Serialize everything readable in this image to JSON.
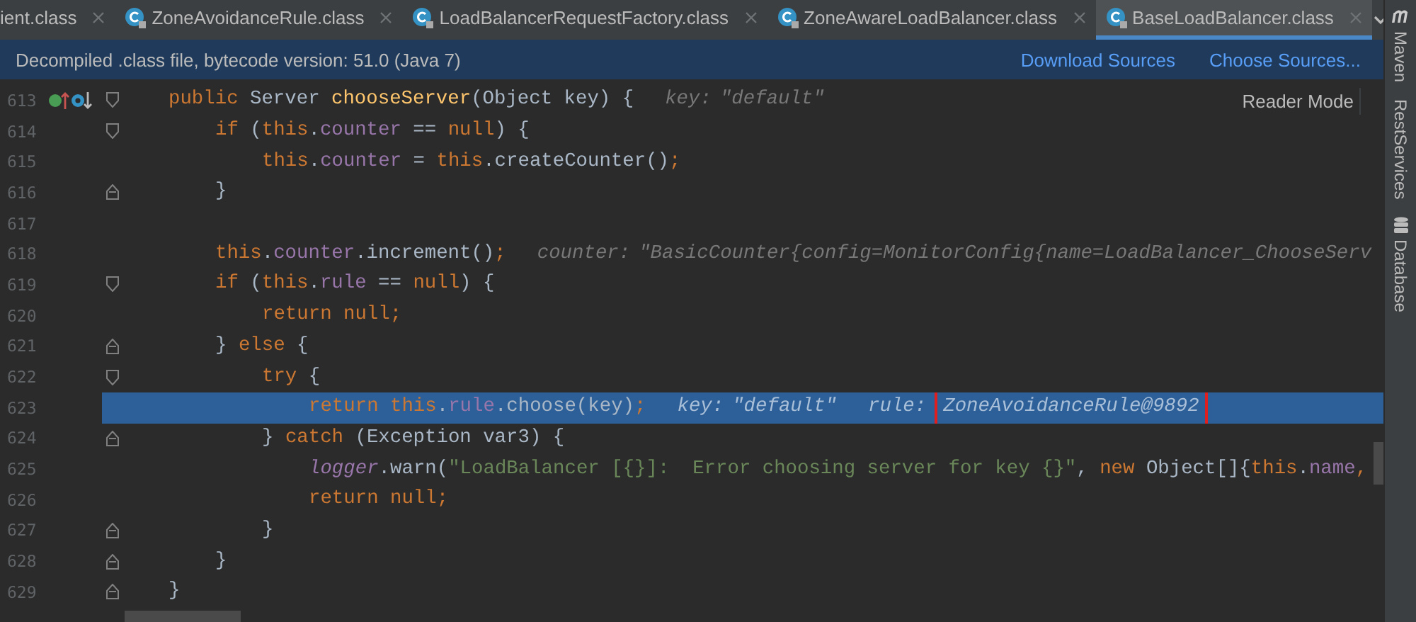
{
  "tabs": [
    {
      "label": "ient.class",
      "icon": false,
      "selected": false
    },
    {
      "label": "ZoneAvoidanceRule.class",
      "icon": true,
      "selected": false
    },
    {
      "label": "LoadBalancerRequestFactory.class",
      "icon": true,
      "selected": false
    },
    {
      "label": "ZoneAwareLoadBalancer.class",
      "icon": true,
      "selected": false
    },
    {
      "label": "BaseLoadBalancer.class",
      "icon": true,
      "selected": true
    }
  ],
  "banner": {
    "text": "Decompiled .class file, bytecode version: 51.0 (Java 7)",
    "links": [
      "Download Sources",
      "Choose Sources..."
    ]
  },
  "reader_mode": "Reader Mode",
  "tool_windows": [
    {
      "kind": "maven",
      "label": "Maven"
    },
    {
      "kind": "plain",
      "label": "RestServices"
    },
    {
      "kind": "database",
      "label": "Database"
    }
  ],
  "lines": [
    {
      "number": "613",
      "markers": true,
      "fold_start": true,
      "fold_end": false,
      "current": false,
      "tokens": [
        {
          "kind": "kw",
          "text": "public "
        },
        {
          "kind": "plain",
          "text": "Server "
        },
        {
          "kind": "decl",
          "text": "chooseServer"
        },
        {
          "kind": "plain",
          "text": "(Object key) {"
        }
      ],
      "hints": [
        {
          "label": "key:",
          "value": "\"default\"",
          "boxed": false
        }
      ]
    },
    {
      "number": "614",
      "markers": false,
      "fold_start": true,
      "fold_end": false,
      "current": false,
      "tokens": [
        {
          "kind": "kw",
          "text": "if "
        },
        {
          "kind": "plain",
          "text": "("
        },
        {
          "kind": "kw",
          "text": "this"
        },
        {
          "kind": "plain",
          "text": "."
        },
        {
          "kind": "field",
          "text": "counter "
        },
        {
          "kind": "plain",
          "text": "== "
        },
        {
          "kind": "kw",
          "text": "null"
        },
        {
          "kind": "plain",
          "text": ") {"
        }
      ]
    },
    {
      "number": "615",
      "markers": false,
      "fold_start": false,
      "fold_end": false,
      "current": false,
      "tokens": [
        {
          "kind": "kw",
          "text": "this"
        },
        {
          "kind": "plain",
          "text": "."
        },
        {
          "kind": "field",
          "text": "counter "
        },
        {
          "kind": "plain",
          "text": "= "
        },
        {
          "kind": "kw",
          "text": "this"
        },
        {
          "kind": "plain",
          "text": ".createCounter()"
        },
        {
          "kind": "kw",
          "text": ";"
        }
      ]
    },
    {
      "number": "616",
      "markers": false,
      "fold_start": false,
      "fold_end": true,
      "current": false,
      "tokens": [
        {
          "kind": "plain",
          "text": "}"
        }
      ]
    },
    {
      "number": "617",
      "markers": false,
      "fold_start": false,
      "fold_end": false,
      "current": false
    },
    {
      "number": "618",
      "markers": false,
      "fold_start": false,
      "fold_end": false,
      "current": false,
      "tokens": [
        {
          "kind": "kw",
          "text": "this"
        },
        {
          "kind": "plain",
          "text": "."
        },
        {
          "kind": "field",
          "text": "counter"
        },
        {
          "kind": "plain",
          "text": ".increment()"
        },
        {
          "kind": "kw",
          "text": ";"
        }
      ],
      "hints": [
        {
          "label": "counter:",
          "value": "\"BasicCounter{config=MonitorConfig{name=LoadBalancer_ChooseServ",
          "boxed": false
        }
      ]
    },
    {
      "number": "619",
      "markers": false,
      "fold_start": true,
      "fold_end": false,
      "current": false,
      "tokens": [
        {
          "kind": "kw",
          "text": "if "
        },
        {
          "kind": "plain",
          "text": "("
        },
        {
          "kind": "kw",
          "text": "this"
        },
        {
          "kind": "plain",
          "text": "."
        },
        {
          "kind": "field",
          "text": "rule "
        },
        {
          "kind": "plain",
          "text": "== "
        },
        {
          "kind": "kw",
          "text": "null"
        },
        {
          "kind": "plain",
          "text": ") {"
        }
      ]
    },
    {
      "number": "620",
      "markers": false,
      "fold_start": false,
      "fold_end": false,
      "current": false,
      "tokens": [
        {
          "kind": "kw",
          "text": "return null;"
        }
      ]
    },
    {
      "number": "621",
      "markers": false,
      "fold_start": false,
      "fold_end": true,
      "current": false,
      "tokens": [
        {
          "kind": "plain",
          "text": "} "
        },
        {
          "kind": "kw",
          "text": "else "
        },
        {
          "kind": "plain",
          "text": "{"
        }
      ]
    },
    {
      "number": "622",
      "markers": false,
      "fold_start": true,
      "fold_end": false,
      "current": false,
      "tokens": [
        {
          "kind": "kw",
          "text": "try "
        },
        {
          "kind": "plain",
          "text": "{"
        }
      ]
    },
    {
      "number": "623",
      "markers": false,
      "fold_start": false,
      "fold_end": false,
      "current": true,
      "tokens": [
        {
          "kind": "kw",
          "text": "return this"
        },
        {
          "kind": "plain",
          "text": "."
        },
        {
          "kind": "field",
          "text": "rule"
        },
        {
          "kind": "plain",
          "text": ".choose(key)"
        },
        {
          "kind": "kw",
          "text": ";"
        }
      ],
      "hints": [
        {
          "label": "key:",
          "value": "\"default\"",
          "boxed": false
        },
        {
          "label": "rule:",
          "value": "ZoneAvoidanceRule@9892",
          "boxed": true
        }
      ]
    },
    {
      "number": "624",
      "markers": false,
      "fold_start": false,
      "fold_end": true,
      "current": false,
      "tokens": [
        {
          "kind": "plain",
          "text": "} "
        },
        {
          "kind": "kw",
          "text": "catch "
        },
        {
          "kind": "plain",
          "text": "(Exception var3) {"
        }
      ]
    },
    {
      "number": "625",
      "markers": false,
      "fold_start": false,
      "fold_end": false,
      "current": false,
      "tokens": [
        {
          "kind": "static",
          "text": "logger"
        },
        {
          "kind": "plain",
          "text": ".warn("
        },
        {
          "kind": "string",
          "text": "\"LoadBalancer [{}]:  Error choosing server for key {}\""
        },
        {
          "kind": "plain",
          "text": ", "
        },
        {
          "kind": "kw",
          "text": "new "
        },
        {
          "kind": "plain",
          "text": "Object[]{"
        },
        {
          "kind": "kw",
          "text": "this"
        },
        {
          "kind": "plain",
          "text": "."
        },
        {
          "kind": "field",
          "text": "name"
        },
        {
          "kind": "kw",
          "text": ","
        }
      ]
    },
    {
      "number": "626",
      "markers": false,
      "fold_start": false,
      "fold_end": false,
      "current": false,
      "tokens": [
        {
          "kind": "kw",
          "text": "return null;"
        }
      ]
    },
    {
      "number": "627",
      "markers": false,
      "fold_start": false,
      "fold_end": true,
      "current": false,
      "tokens": [
        {
          "kind": "plain",
          "text": "}"
        }
      ]
    },
    {
      "number": "628",
      "markers": false,
      "fold_start": false,
      "fold_end": true,
      "current": false,
      "tokens": [
        {
          "kind": "plain",
          "text": "}"
        }
      ]
    },
    {
      "number": "629",
      "markers": false,
      "fold_start": false,
      "fold_end": true,
      "current": false,
      "tokens": [
        {
          "kind": "plain",
          "text": "}"
        }
      ]
    }
  ]
}
